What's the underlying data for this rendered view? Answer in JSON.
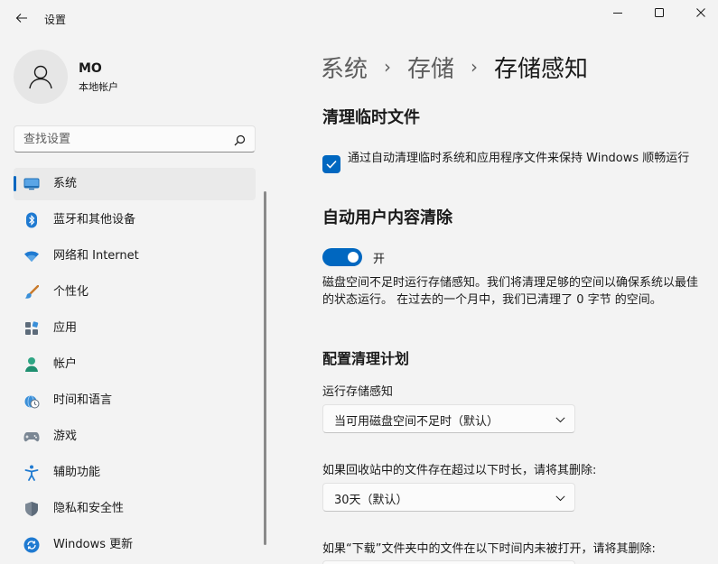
{
  "window": {
    "title": "设置"
  },
  "user": {
    "name": "MO",
    "account_type": "本地帐户"
  },
  "search": {
    "placeholder": "查找设置",
    "value": ""
  },
  "sidebar": {
    "items": [
      {
        "label": "系统",
        "icon": "monitor-icon",
        "selected": true
      },
      {
        "label": "蓝牙和其他设备",
        "icon": "bluetooth-icon",
        "selected": false
      },
      {
        "label": "网络和 Internet",
        "icon": "wifi-icon",
        "selected": false
      },
      {
        "label": "个性化",
        "icon": "paintbrush-icon",
        "selected": false
      },
      {
        "label": "应用",
        "icon": "apps-icon",
        "selected": false
      },
      {
        "label": "帐户",
        "icon": "person-icon",
        "selected": false
      },
      {
        "label": "时间和语言",
        "icon": "clock-globe-icon",
        "selected": false
      },
      {
        "label": "游戏",
        "icon": "gamepad-icon",
        "selected": false
      },
      {
        "label": "辅助功能",
        "icon": "accessibility-icon",
        "selected": false
      },
      {
        "label": "隐私和安全性",
        "icon": "shield-icon",
        "selected": false
      },
      {
        "label": "Windows 更新",
        "icon": "sync-icon",
        "selected": false
      }
    ]
  },
  "breadcrumb": {
    "items": [
      "系统",
      "存储",
      "存储感知"
    ]
  },
  "content": {
    "cleanup_temp": {
      "title": "清理临时文件",
      "checkbox_label": "通过自动清理临时系统和应用程序文件来保持 Windows 顺畅运行",
      "checked": true
    },
    "auto_cleanup": {
      "title": "自动用户内容清除",
      "toggle_label": "开",
      "toggle_on": true,
      "description": "磁盘空间不足时运行存储感知。我们将清理足够的空间以确保系统以最佳的状态运行。 在过去的一个月中，我们已清理了 0 字节 的空间。"
    },
    "schedule": {
      "title": "配置清理计划",
      "run_label": "运行存储感知",
      "run_value": "当可用磁盘空间不足时（默认）",
      "recycle_label": "如果回收站中的文件存在超过以下时长，请将其删除:",
      "recycle_value": "30天（默认）",
      "downloads_label": "如果“下载”文件夹中的文件在以下时间内未被打开，请将其删除:"
    }
  },
  "colors": {
    "accent": "#0067c0",
    "background": "#f3f3f3"
  }
}
